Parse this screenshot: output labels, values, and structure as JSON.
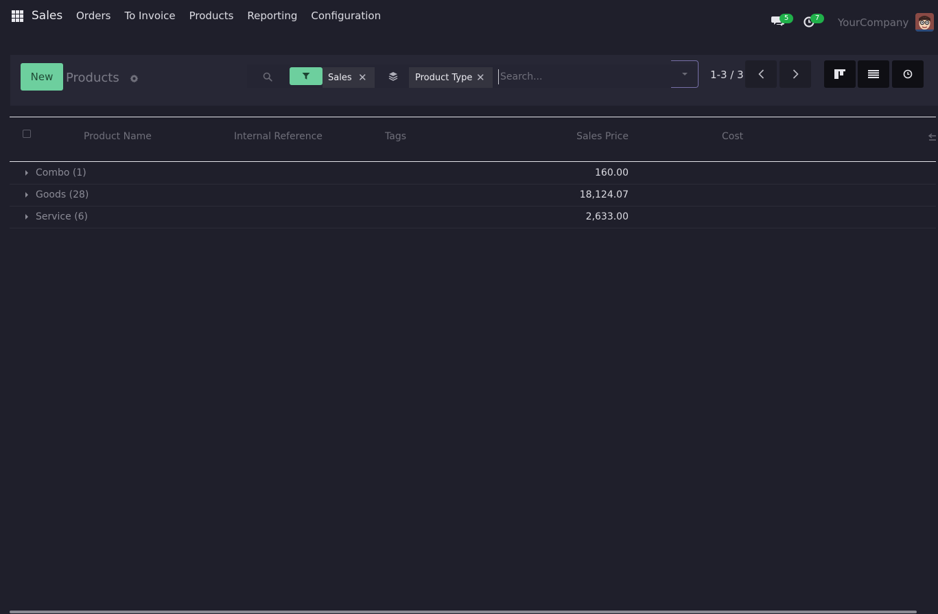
{
  "navbar": {
    "brand": "Sales",
    "menu": [
      "Orders",
      "To Invoice",
      "Products",
      "Reporting",
      "Configuration"
    ],
    "messages_count": "5",
    "activities_count": "7",
    "company": "YourCompany"
  },
  "control_panel": {
    "new_label": "New",
    "title": "Products",
    "facets": {
      "filter_value": "Sales",
      "groupby_value": "Product Type"
    },
    "search_placeholder": "Search...",
    "pager": "1-3 / 3"
  },
  "list": {
    "columns": [
      "Product Name",
      "Internal Reference",
      "Tags",
      "Sales Price",
      "Cost"
    ],
    "groups": [
      {
        "name": "Combo (1)",
        "sales_price": "160.00"
      },
      {
        "name": "Goods (28)",
        "sales_price": "18,124.07"
      },
      {
        "name": "Service (6)",
        "sales_price": "2,633.00"
      }
    ]
  },
  "colors": {
    "background": "#1f1f2b",
    "accent": "#6dcf9e",
    "badge": "#20b04a"
  }
}
